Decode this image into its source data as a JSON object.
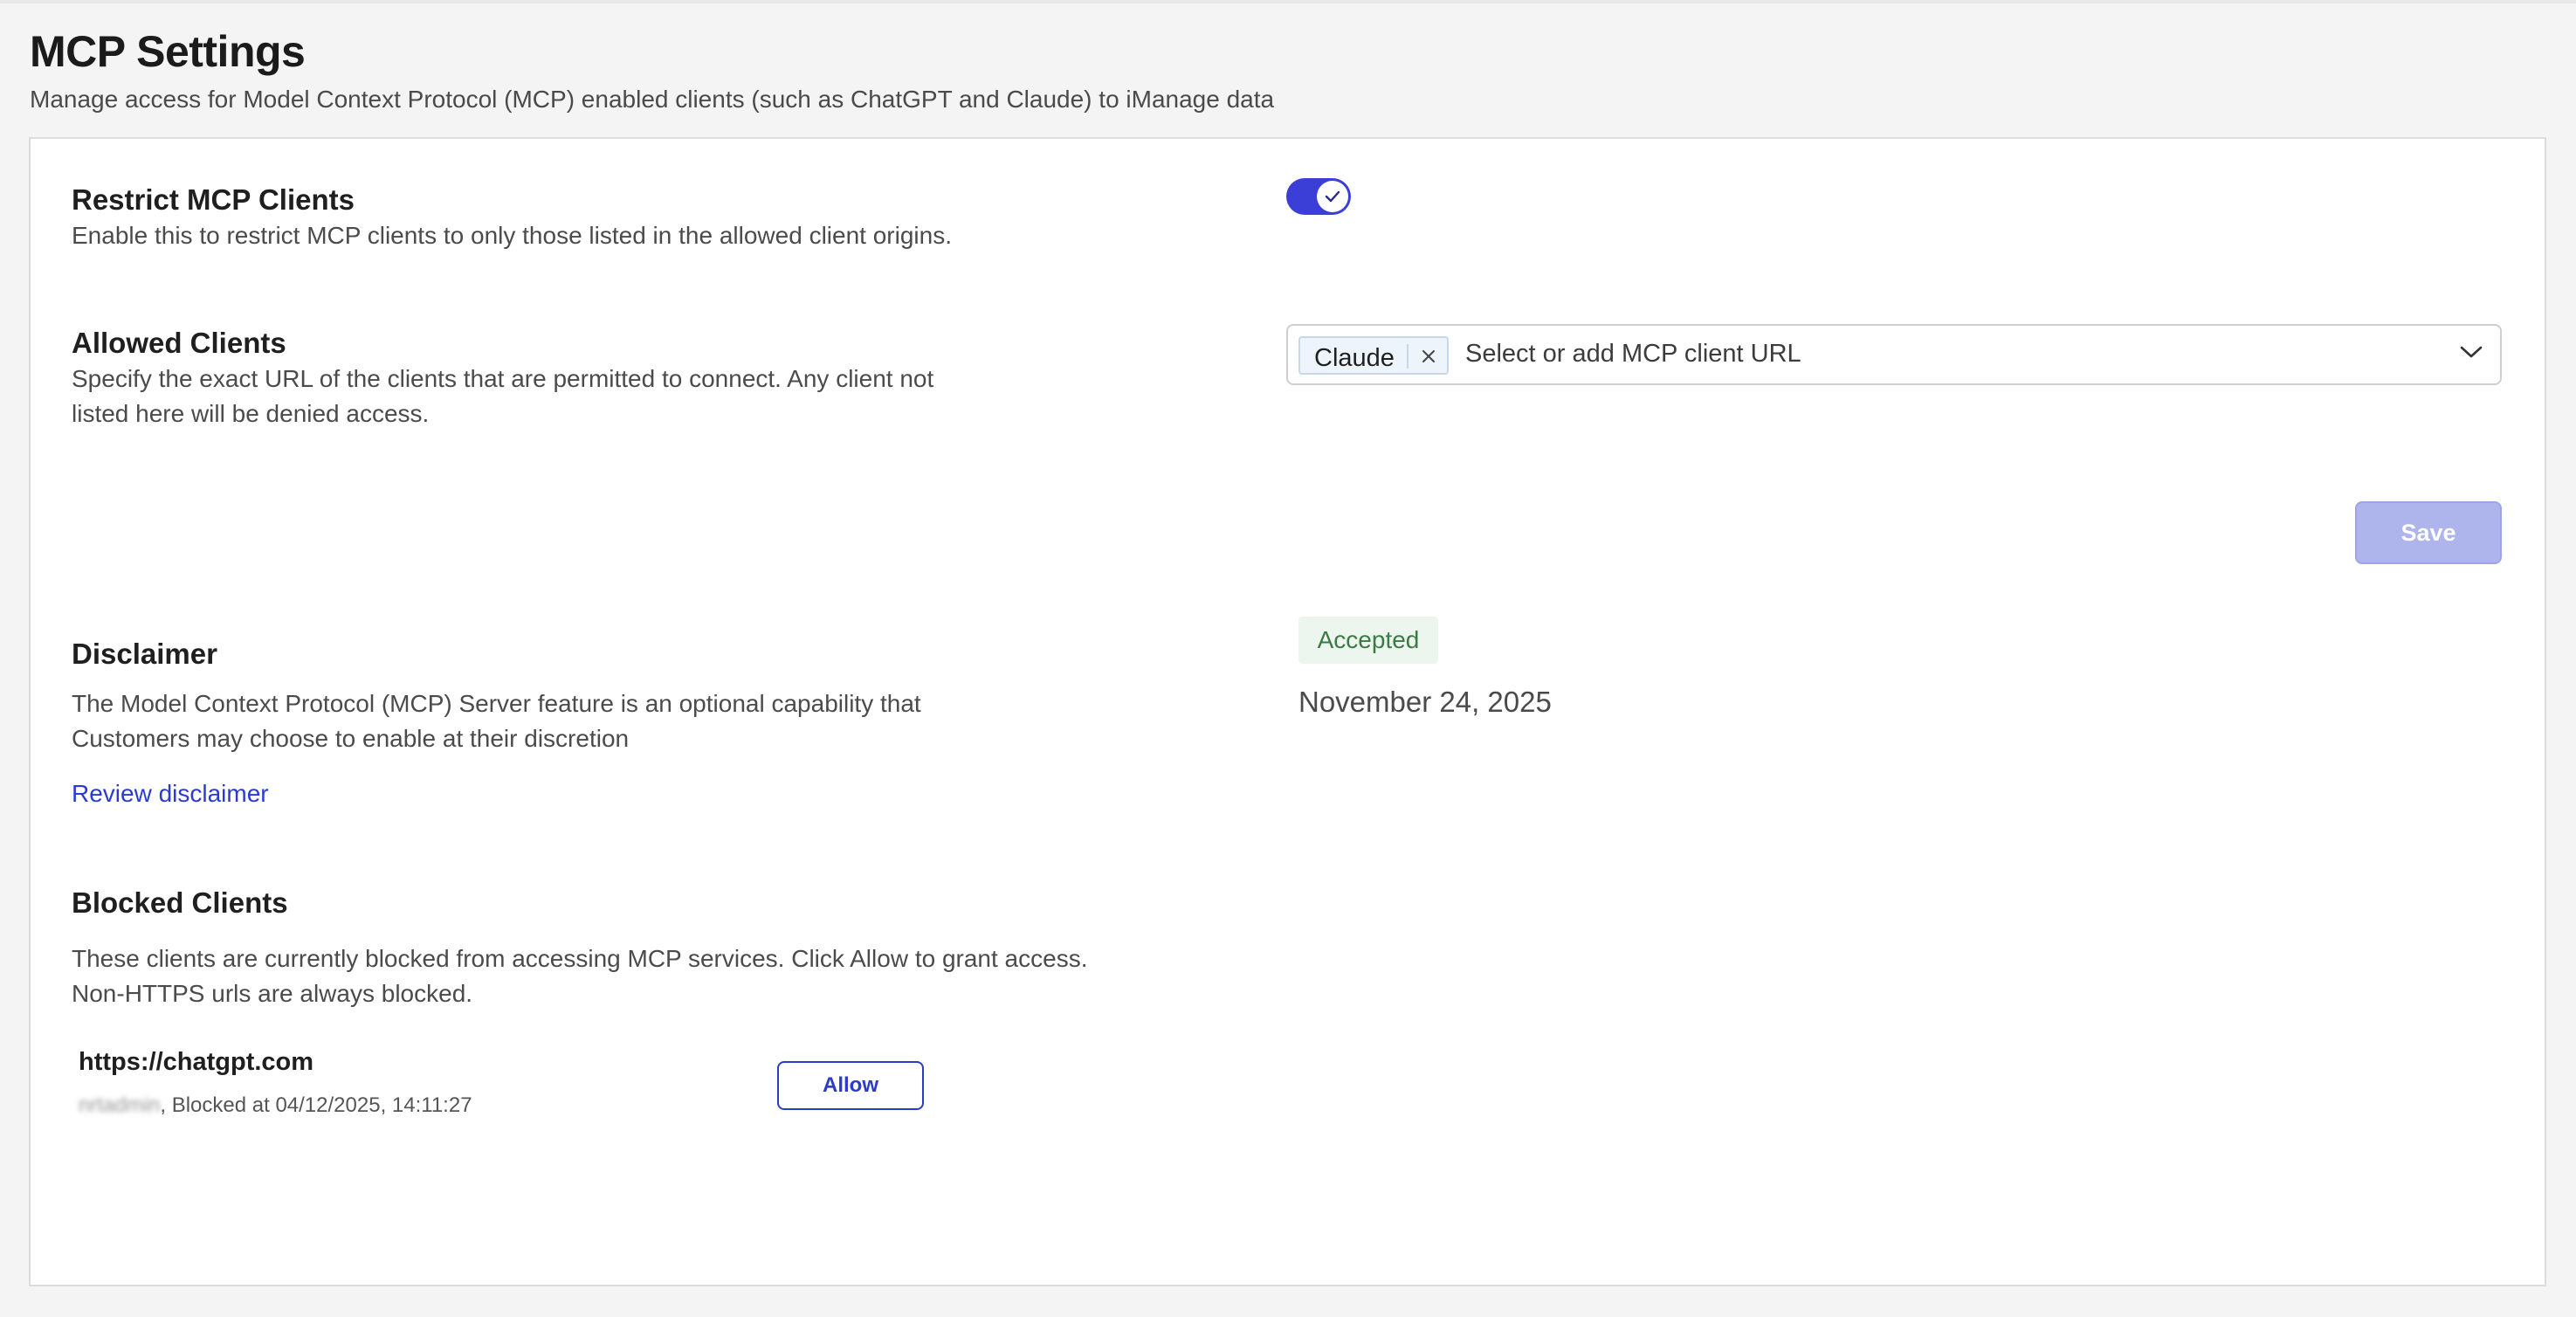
{
  "header": {
    "title": "MCP Settings",
    "subtitle": "Manage access for Model Context Protocol (MCP) enabled clients (such as ChatGPT and Claude) to iManage data"
  },
  "restrict": {
    "title": "Restrict MCP Clients",
    "description": "Enable this to restrict MCP clients to only those listed in the allowed client origins.",
    "enabled": true
  },
  "allowed": {
    "title": "Allowed Clients",
    "description_line1": "Specify the exact URL of the clients that are permitted to connect. Any client not",
    "description_line2": "listed here will be denied access.",
    "selected": [
      "Claude"
    ],
    "placeholder": "Select or add MCP client URL"
  },
  "save_label": "Save",
  "disclaimer": {
    "title": "Disclaimer",
    "description_line1": "The Model Context Protocol (MCP) Server feature is an optional capability that",
    "description_line2": "Customers may choose to enable at their discretion",
    "link": "Review disclaimer",
    "status": "Accepted",
    "date": "November 24, 2025"
  },
  "blocked": {
    "title": "Blocked Clients",
    "description_line1": "These clients are currently blocked from accessing MCP services. Click Allow to grant access.",
    "description_line2": "Non-HTTPS urls are always blocked.",
    "items": [
      {
        "url": "https://chatgpt.com",
        "user": "nrtadmin",
        "blocked_text": ", Blocked at 04/12/2025, 14:11:27",
        "action": "Allow"
      }
    ]
  },
  "colors": {
    "accent": "#3b3fd8",
    "link": "#2b3bd0",
    "accepted": "#3b7a44"
  }
}
